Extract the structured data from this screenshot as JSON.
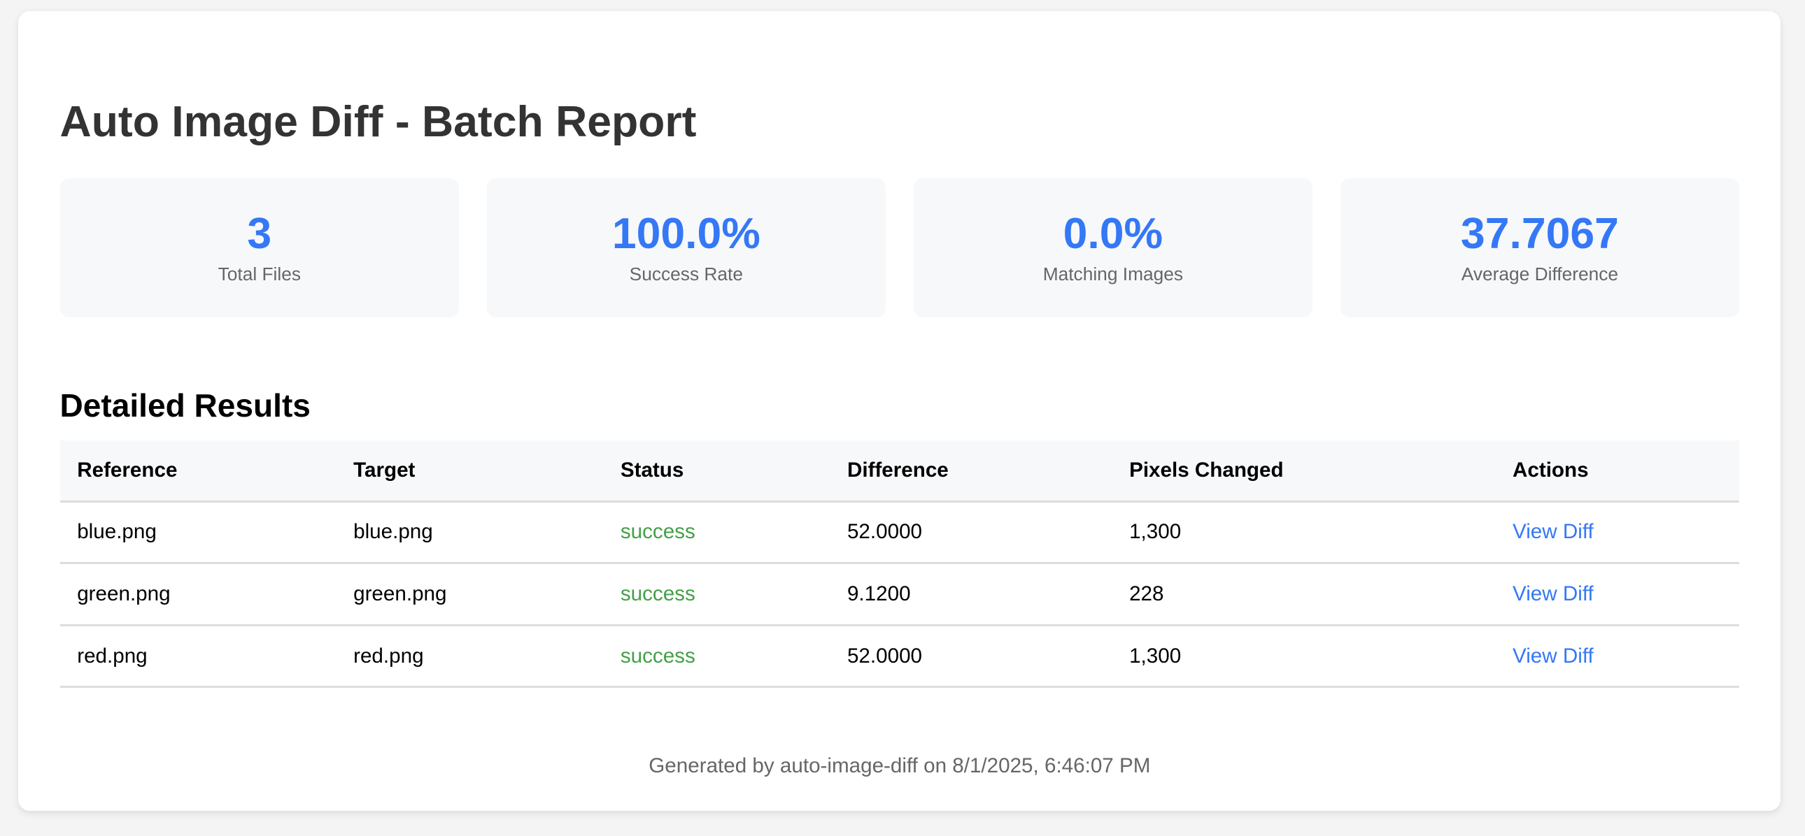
{
  "title": "Auto Image Diff - Batch Report",
  "stats": [
    {
      "value": "3",
      "label": "Total Files"
    },
    {
      "value": "100.0%",
      "label": "Success Rate"
    },
    {
      "value": "0.0%",
      "label": "Matching Images"
    },
    {
      "value": "37.7067",
      "label": "Average Difference"
    }
  ],
  "section_title": "Detailed Results",
  "table": {
    "headers": [
      "Reference",
      "Target",
      "Status",
      "Difference",
      "Pixels Changed",
      "Actions"
    ],
    "rows": [
      {
        "reference": "blue.png",
        "target": "blue.png",
        "status": "success",
        "difference": "52.0000",
        "pixels": "1,300",
        "action": "View Diff"
      },
      {
        "reference": "green.png",
        "target": "green.png",
        "status": "success",
        "difference": "9.1200",
        "pixels": "228",
        "action": "View Diff"
      },
      {
        "reference": "red.png",
        "target": "red.png",
        "status": "success",
        "difference": "52.0000",
        "pixels": "1,300",
        "action": "View Diff"
      }
    ]
  },
  "footer": "Generated by auto-image-diff on 8/1/2025, 6:46:07 PM",
  "colors": {
    "accent": "#3478f6",
    "success": "#43a047"
  }
}
